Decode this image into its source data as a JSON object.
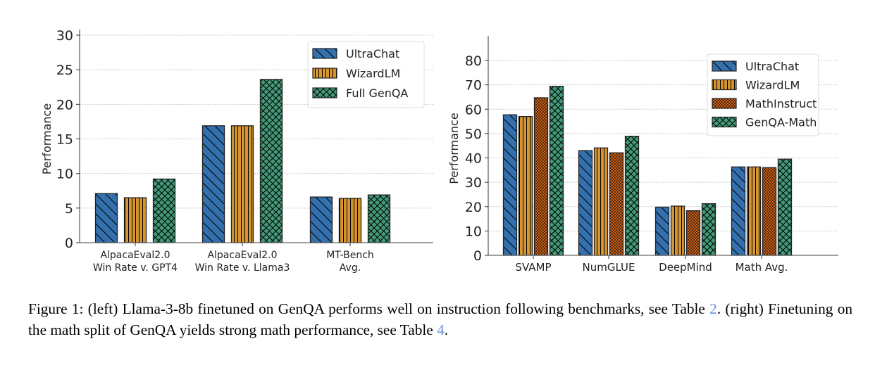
{
  "chart_data": [
    {
      "type": "bar",
      "categories": [
        "AlpacaEval2.0\nWin Rate v. GPT4",
        "AlpacaEval2.0\nWin Rate v. Llama3",
        "MT-Bench\nAvg."
      ],
      "ylabel": "Performance",
      "xlabel": "",
      "ylim": [
        0,
        30
      ],
      "yticks": [
        0,
        5,
        10,
        15,
        20,
        25,
        30
      ],
      "grid": "horizontal dotted",
      "legend": "top-right",
      "series": [
        {
          "name": "UltraChat",
          "values": [
            7.1,
            16.9,
            6.6
          ],
          "color": "#3470ad",
          "hatch": "diagonal"
        },
        {
          "name": "WizardLM",
          "values": [
            6.5,
            16.9,
            6.4
          ],
          "color": "#d6952f",
          "hatch": "vertical"
        },
        {
          "name": "Full GenQA",
          "values": [
            9.2,
            23.6,
            6.9
          ],
          "color": "#439a78",
          "hatch": "crosshatch"
        }
      ]
    },
    {
      "type": "bar",
      "categories": [
        "SVAMP",
        "NumGLUE",
        "DeepMind",
        "Math Avg."
      ],
      "ylabel": "Performance",
      "xlabel": "",
      "ylim": [
        0,
        85
      ],
      "yticks": [
        0,
        10,
        20,
        30,
        40,
        50,
        60,
        70,
        80
      ],
      "grid": "horizontal dotted",
      "legend": "top-right",
      "series": [
        {
          "name": "UltraChat",
          "values": [
            57.7,
            43.0,
            19.8,
            36.3
          ],
          "color": "#3470ad",
          "hatch": "diagonal"
        },
        {
          "name": "WizardLM",
          "values": [
            57.0,
            44.1,
            20.2,
            36.3
          ],
          "color": "#d6952f",
          "hatch": "vertical"
        },
        {
          "name": "MathInstruct",
          "values": [
            64.7,
            42.1,
            18.3,
            36.0
          ],
          "color": "#c8611a",
          "hatch": "dots"
        },
        {
          "name": "GenQA-Math",
          "values": [
            69.4,
            48.9,
            21.2,
            39.5
          ],
          "color": "#439a78",
          "hatch": "crosshatch"
        }
      ]
    }
  ],
  "caption": {
    "part1": "Figure 1: (left) Llama-3-8b finetuned on GenQA performs well on instruction following benchmarks, see Table ",
    "ref1": "2",
    "part2": ".  (right) Finetuning on the math split of GenQA yields strong math performance, see Table ",
    "ref2": "4",
    "part3": "."
  }
}
